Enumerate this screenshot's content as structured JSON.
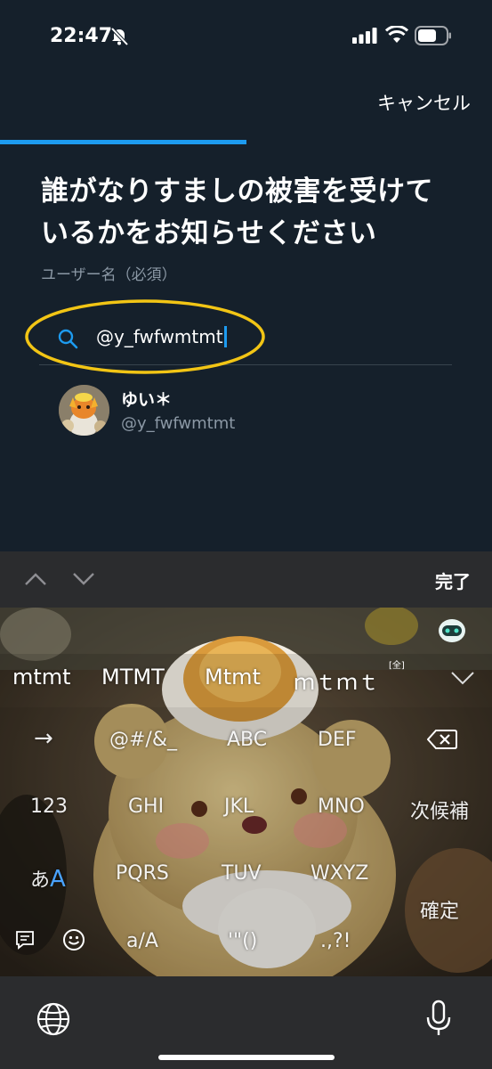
{
  "status_bar": {
    "time": "22:47"
  },
  "header": {
    "cancel_label": "キャンセル",
    "progress": 0.5
  },
  "form": {
    "title": "誰がなりすましの被害を受けているかをお知らせください",
    "field_label": "ユーザー名（必須）",
    "search_value": "@y_fwfwmtmt"
  },
  "results": [
    {
      "name": "ゆい＊",
      "handle": "@y_fwfwmtmt"
    }
  ],
  "keyboard_toolbar": {
    "done_label": "完了"
  },
  "keyboard": {
    "candidates": [
      "mtmt",
      "MTMT",
      "Mtmt",
      "ｍｔｍｔ"
    ],
    "candidate_superscript": "[全]",
    "keys": {
      "arrow": "→",
      "symbols": "@#/&_",
      "abc": "ABC",
      "def": "DEF",
      "num": "123",
      "ghi": "GHI",
      "jkl": "JKL",
      "mno": "MNO",
      "next_candidate": "次候補",
      "kana_a": "あ",
      "kana_A": "A",
      "pqrs": "PQRS",
      "tuv": "TUV",
      "wxyz": "WXYZ",
      "confirm": "確定",
      "case_toggle": "a/A",
      "quotes": "'\"()",
      "punct": ".,?!"
    }
  }
}
